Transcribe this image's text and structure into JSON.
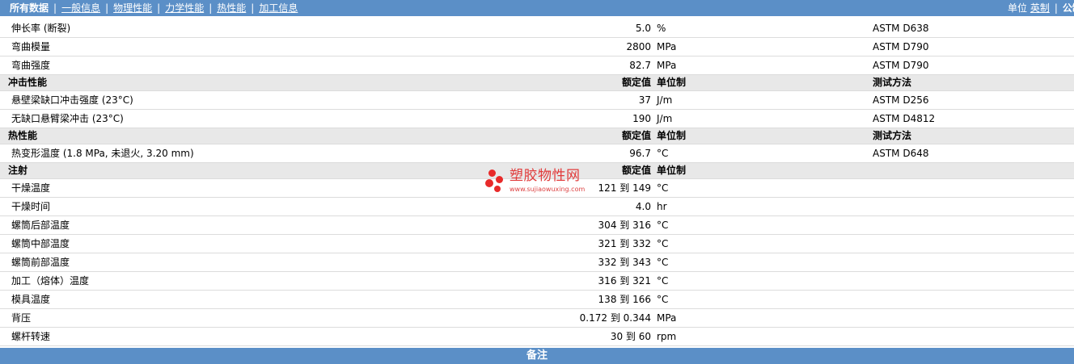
{
  "nav": {
    "tabs": [
      "所有数据",
      "一般信息",
      "物理性能",
      "力学性能",
      "热性能",
      "加工信息"
    ],
    "active_tab": "所有数据",
    "units_label": "单位",
    "units_options": [
      "英制",
      "公制"
    ],
    "selected_unit": "公制"
  },
  "rows": [
    {
      "name": "伸长率 (断裂)",
      "value": "5.0",
      "unit": "%",
      "method": "ASTM D638"
    },
    {
      "name": "弯曲模量",
      "value": "2800",
      "unit": "MPa",
      "method": "ASTM D790"
    },
    {
      "name": "弯曲强度",
      "value": "82.7",
      "unit": "MPa",
      "method": "ASTM D790"
    },
    {
      "section": true,
      "name": "冲击性能",
      "value": "额定值",
      "unit": "单位制",
      "method": "测试方法"
    },
    {
      "name": "悬壁梁缺口冲击强度 (23°C)",
      "value": "37",
      "unit": "J/m",
      "method": "ASTM D256"
    },
    {
      "name": "无缺口悬臂梁冲击 (23°C)",
      "value": "190",
      "unit": "J/m",
      "method": "ASTM D4812"
    },
    {
      "section": true,
      "name": "热性能",
      "value": "额定值",
      "unit": "单位制",
      "method": "测试方法"
    },
    {
      "name": "热变形温度 (1.8 MPa, 未退火, 3.20 mm)",
      "value": "96.7",
      "unit": "°C",
      "method": "ASTM D648"
    },
    {
      "section": true,
      "name": "注射",
      "value": "额定值",
      "unit": "单位制",
      "method": ""
    },
    {
      "name": "干燥温度",
      "value": "121 到 149",
      "unit": "°C",
      "method": ""
    },
    {
      "name": "干燥时间",
      "value": "4.0",
      "unit": "hr",
      "method": ""
    },
    {
      "name": "螺筒后部温度",
      "value": "304 到 316",
      "unit": "°C",
      "method": ""
    },
    {
      "name": "螺筒中部温度",
      "value": "321 到 332",
      "unit": "°C",
      "method": ""
    },
    {
      "name": "螺筒前部温度",
      "value": "332 到 343",
      "unit": "°C",
      "method": ""
    },
    {
      "name": "加工（熔体）温度",
      "value": "316 到 321",
      "unit": "°C",
      "method": ""
    },
    {
      "name": "模具温度",
      "value": "138 到 166",
      "unit": "°C",
      "method": ""
    },
    {
      "name": "背压",
      "value": "0.172 到 0.344",
      "unit": "MPa",
      "method": ""
    },
    {
      "name": "螺杆转速",
      "value": "30 到 60",
      "unit": "rpm",
      "method": ""
    }
  ],
  "footer": {
    "label": "备注"
  },
  "watermark": {
    "title": "塑胶物性网",
    "url": "www.sujiaowuxing.com"
  },
  "colors": {
    "header_bg": "#5b8fc7",
    "section_bg": "#e8e8e8",
    "watermark": "#e82a2a"
  }
}
